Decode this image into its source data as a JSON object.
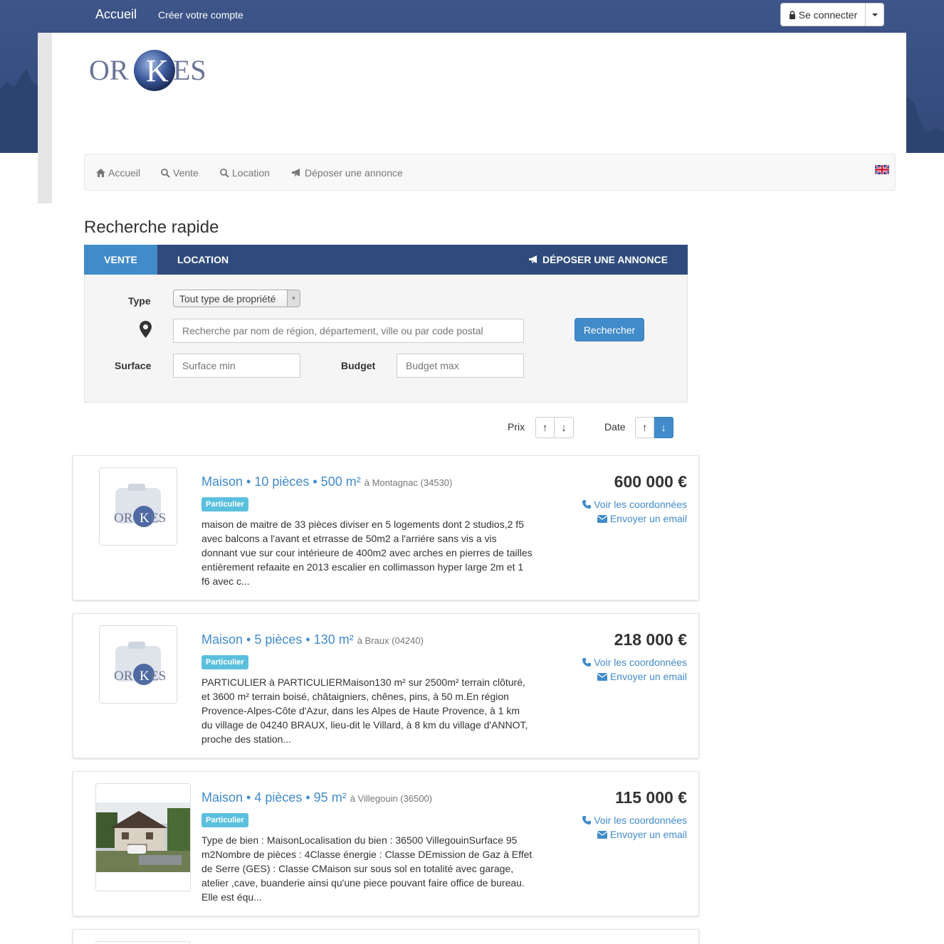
{
  "topnav": {
    "brand": "Accueil",
    "create_account": "Créer votre compte",
    "signin": "Se connecter"
  },
  "logo": {
    "text": "ORKES"
  },
  "subnav": {
    "items": [
      "Accueil",
      "Vente",
      "Location",
      "Déposer une annonce"
    ]
  },
  "quick_search": {
    "title": "Recherche rapide",
    "tabs": [
      "Vente",
      "Location",
      "Déposer une annonce"
    ],
    "type_label": "Type",
    "type_value": "Tout type de propriété",
    "location_placeholder": "Recherche par nom de région, département, ville ou par code postal",
    "surface_label": "Surface",
    "surface_placeholder": "Surface min",
    "budget_label": "Budget",
    "budget_placeholder": "Budget max",
    "search_button": "Rechercher"
  },
  "sort": {
    "price_label": "Prix",
    "date_label": "Date",
    "up": "↑",
    "down": "↓"
  },
  "listings": [
    {
      "title": "Maison • 10 pièces • 500 m²",
      "location": "à Montagnac (34530)",
      "badge": "Particulier",
      "description": "maison de maitre de 33 pièces diviser en 5 logements dont 2 studios,2 f5 avec balcons a l'avant et etrrasse de 50m2 a l'arriére sans vis a vis donnant vue sur cour intérieure de 400m2 avec arches en pierres de tailles entièrement refaaite en 2013 escalier en collimasson hyper large 2m et 1 f6 avec c...",
      "price": "600 000 €",
      "contact": "Voir les coordonnées",
      "email": "Envoyer un email"
    },
    {
      "title": "Maison • 5 pièces • 130 m²",
      "location": "à Braux (04240)",
      "badge": "Particulier",
      "description": "PARTICULIER à PARTICULIERMaison130 m² sur 2500m² terrain clôturé, et 3600 m² terrain boisé, châtaigniers, chênes, pins, à 50 m.En région Provence-Alpes-Côte d'Azur, dans les Alpes de Haute Provence, à 1 km du village de 04240 BRAUX, lieu-dit le Villard, à 8 km du village d'ANNOT, proche des station...",
      "price": "218 000 €",
      "contact": "Voir les coordonnées",
      "email": "Envoyer un email"
    },
    {
      "title": "Maison • 4 pièces • 95 m²",
      "location": "à Villegouin (36500)",
      "badge": "Particulier",
      "description": "Type de bien : MaisonLocalisation du bien : 36500 VillegouinSurface 95 m2Nombre de pièces : 4Classe énergie : Classe DEmission de Gaz à Effet de Serre (GES) : Classe CMaison sur sous sol en totalité avec garage, atelier ,cave, buanderie ainsi qu'une piece pouvant faire office de bureau. Elle est équ...",
      "price": "115 000 €",
      "contact": "Voir les coordonnées",
      "email": "Envoyer un email"
    }
  ]
}
